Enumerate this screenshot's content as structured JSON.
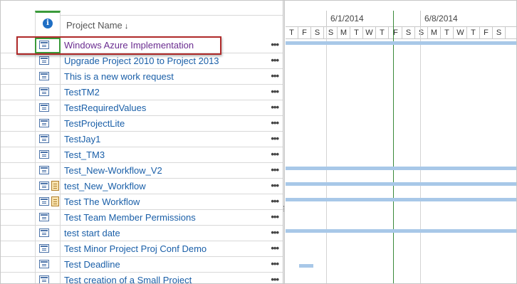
{
  "grid": {
    "header": {
      "info_icon_glyph": "i",
      "name_label": "Project Name",
      "sort_glyph": "↓"
    },
    "rows": [
      {
        "name": "Windows Azure Implementation",
        "visited": true,
        "extra_icon": false
      },
      {
        "name": "Upgrade Project 2010 to Project 2013",
        "visited": false,
        "extra_icon": false
      },
      {
        "name": "This is a new work request",
        "visited": false,
        "extra_icon": false
      },
      {
        "name": "TestTM2",
        "visited": false,
        "extra_icon": false
      },
      {
        "name": "TestRequiredValues",
        "visited": false,
        "extra_icon": false
      },
      {
        "name": "TestProjectLite",
        "visited": false,
        "extra_icon": false
      },
      {
        "name": "TestJay1",
        "visited": false,
        "extra_icon": false
      },
      {
        "name": "Test_TM3",
        "visited": false,
        "extra_icon": false
      },
      {
        "name": "Test_New-Workflow_V2",
        "visited": false,
        "extra_icon": false
      },
      {
        "name": "test_New_Workflow",
        "visited": false,
        "extra_icon": true
      },
      {
        "name": "Test The Workflow",
        "visited": false,
        "extra_icon": true
      },
      {
        "name": "Test Team Member Permissions",
        "visited": false,
        "extra_icon": false
      },
      {
        "name": "test start date",
        "visited": false,
        "extra_icon": false
      },
      {
        "name": "Test Minor Project Proj Conf Demo",
        "visited": false,
        "extra_icon": false
      },
      {
        "name": "Test Deadline",
        "visited": false,
        "extra_icon": false
      },
      {
        "name": "Test creation of a Small Project",
        "visited": false,
        "extra_icon": false
      }
    ],
    "ellipsis": "•••"
  },
  "gantt": {
    "weeks": [
      "6/1/2014",
      "6/8/2014"
    ],
    "days": [
      "T",
      "F",
      "S",
      "S",
      "M",
      "T",
      "W",
      "T",
      "F",
      "S",
      "S",
      "M",
      "T",
      "W",
      "T",
      "F",
      "S"
    ]
  },
  "colors": {
    "link": "#1a5fa8",
    "visited_link": "#6a2c90",
    "selection": "#3a9a3a",
    "callout": "#b02a2a",
    "gantt_bar": "#a8c8e8"
  }
}
